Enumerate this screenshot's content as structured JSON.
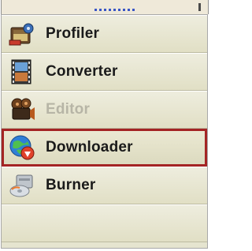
{
  "menu": {
    "items": [
      {
        "label": "Profiler",
        "icon": "film-reel-icon",
        "enabled": true,
        "selected": false
      },
      {
        "label": "Converter",
        "icon": "film-strip-icon",
        "enabled": true,
        "selected": false
      },
      {
        "label": "Editor",
        "icon": "film-camera-icon",
        "enabled": false,
        "selected": false
      },
      {
        "label": "Downloader",
        "icon": "globe-download-icon",
        "enabled": true,
        "selected": true
      },
      {
        "label": "Burner",
        "icon": "disc-burner-icon",
        "enabled": true,
        "selected": false
      }
    ]
  },
  "colors": {
    "panel_bg": "#e5e4cf",
    "selected_border": "#a42424",
    "disabled_text": "#b7b5a6",
    "text": "#1a1a1a"
  }
}
